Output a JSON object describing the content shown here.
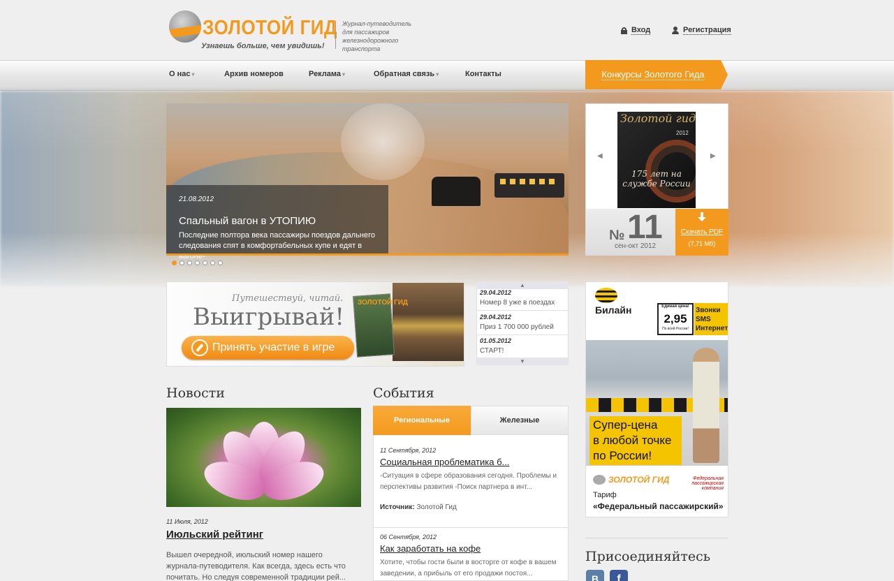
{
  "header": {
    "logo_title": "ЗОЛОТОЙ ГИД",
    "logo_slogan": "Узнаешь больше, чем увидишь!",
    "logo_desc": "Журнал-путеводитель для пассажиров железнодорожного транспорта",
    "login_label": "Вход",
    "register_label": "Регистрация"
  },
  "nav": {
    "items": [
      {
        "label": "О нас",
        "dropdown": true
      },
      {
        "label": "Архив номеров",
        "dropdown": false
      },
      {
        "label": "Реклама",
        "dropdown": true
      },
      {
        "label": "Обратная связь",
        "dropdown": true
      },
      {
        "label": "Контакты",
        "dropdown": false
      }
    ],
    "contest_label": "Конкурсы Золотого Гида",
    "caret": "▾"
  },
  "slider": {
    "date": "21.08.2012",
    "title": "Спальный вагон в УТОПИЮ",
    "text": "Последние полтора века пассажиры поездов дальнего следования спят в комфортабельных купе и едят в вагоне-",
    "dots_total": 7,
    "dots_active": 1
  },
  "magazine": {
    "cover_title": "Золотой гид",
    "cover_year": "2012",
    "cover_banner": "175 лет на службе России",
    "number_prefix": "№",
    "number": "11",
    "date": "сен-окт 2012",
    "download_label": "Скачать PDF",
    "download_size": "(7,71 Мб)",
    "prev_arrow": "◀",
    "next_arrow": "▶"
  },
  "game_banner": {
    "subtitle": "Путешествуй, читай.",
    "title": "Выигрывай!",
    "button_label": "Принять участие в игре",
    "book_title": "ЗОЛОТОЙ ГИД"
  },
  "ticker": {
    "up_arrow": "▲",
    "down_arrow": "▼",
    "items": [
      {
        "date": "29.04.2012",
        "text": "Номер 8 уже в поездах"
      },
      {
        "date": "29.04.2012",
        "text": "Приз 1 700 000 рублей"
      },
      {
        "date": "01.05.2012",
        "text": "СТАРТ!"
      }
    ]
  },
  "ad": {
    "brand": "Билайн",
    "price_top": "Единая цена!",
    "price": "2,95",
    "price_bottom": "По всей России!",
    "services": [
      "Звонки",
      "SMS",
      "Интернет"
    ],
    "slogan_lines": [
      "Супер-цена",
      "в любой точке",
      "по России!"
    ],
    "partner_logo": "ЗОЛОТОЙ ГИД",
    "partner2": "Федеральная пассажирская компания",
    "tariff_label": "Тариф",
    "tariff_name": "«Федеральный пассажирский»",
    "brand_color": "#f5c400"
  },
  "news": {
    "heading": "Новости",
    "date": "11 Июля, 2012",
    "title": "Июльский рейтинг",
    "text": "Вышел очередной, июльский номер нашего журнала-путеводителя. Как всегда, здесь есть что почитать. Но следуя современной традиции рей..."
  },
  "events": {
    "heading": "События",
    "tabs": [
      "Региональные",
      "Железные"
    ],
    "items": [
      {
        "date": "11 Сентября, 2012",
        "title": "Социальная проблематика б...",
        "text": "-Ситуация в сфере образования сегодня. Проблемы и перспективы развития -Поиск партнера в инт...",
        "source_label": "Источник:",
        "source": "Золотой Гид"
      },
      {
        "date": "06 Сентября, 2012",
        "title": "Как заработать на кофе",
        "text": "Хотите, чтобы гости были в восторге от кофе в вашем заведении, а прибыль от его продажи постоя..."
      }
    ]
  },
  "social": {
    "heading": "Присоединяйтесь",
    "vk": "В",
    "fb": "f"
  },
  "colors": {
    "accent": "#f39a1e",
    "text": "#333333",
    "background": "#efefef"
  }
}
